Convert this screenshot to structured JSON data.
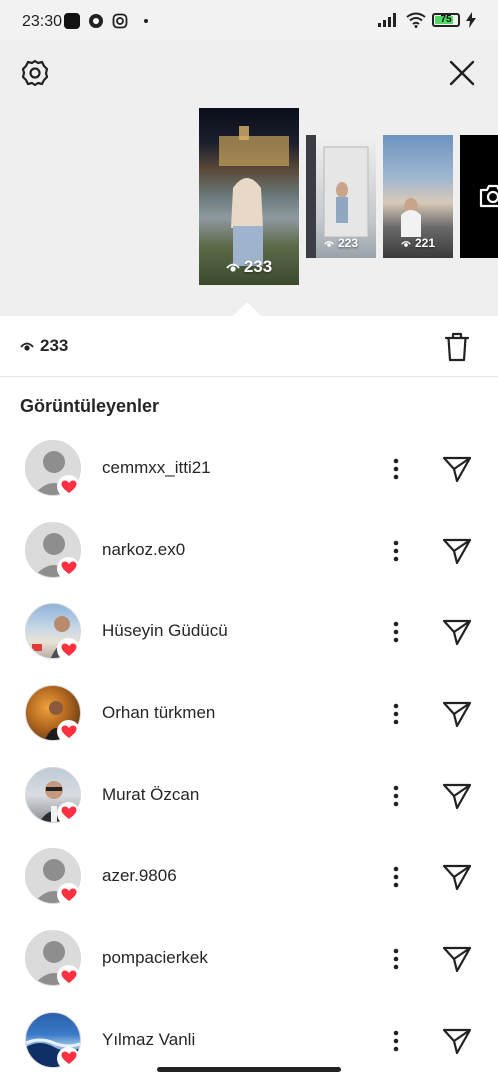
{
  "status_bar": {
    "time": "23:30",
    "battery_level": "75",
    "left_icons": [
      "app-icon",
      "football-icon",
      "instagram-icon",
      "dot-icon"
    ],
    "right_icons": [
      "signal-icon",
      "wifi-icon",
      "battery-icon",
      "charging-icon"
    ]
  },
  "header": {
    "settings_icon": "gear-icon",
    "close_icon": "close-icon"
  },
  "stories": [
    {
      "views": "233",
      "selected": true
    },
    {
      "views": "223",
      "selected": false
    },
    {
      "views": "221",
      "selected": false
    },
    {
      "views": "",
      "selected": false,
      "icon": "camera-icon"
    }
  ],
  "stats": {
    "views": "233",
    "delete_icon": "trash-icon"
  },
  "viewers_title": "Görüntüleyenler",
  "viewers": [
    {
      "name": "cemmxx_itti21",
      "avatar": "default"
    },
    {
      "name": "narkoz.ex0",
      "avatar": "default"
    },
    {
      "name": "Hüseyin Güdücü",
      "avatar": "photo"
    },
    {
      "name": "Orhan türkmen",
      "avatar": "photo"
    },
    {
      "name": "Murat Özcan",
      "avatar": "photo"
    },
    {
      "name": "azer.9806",
      "avatar": "default"
    },
    {
      "name": "pompacierkek",
      "avatar": "default"
    },
    {
      "name": "Yılmaz Vanli",
      "avatar": "photo"
    }
  ],
  "colors": {
    "heart": "#ff3040",
    "battery": "#4cd964",
    "text": "#262626"
  }
}
